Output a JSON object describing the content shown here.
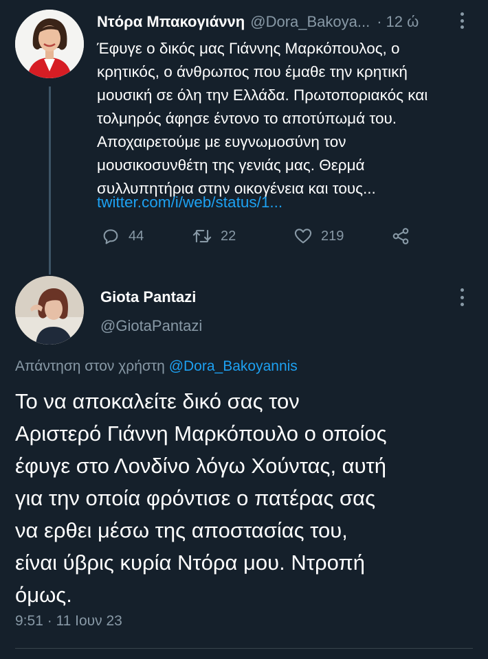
{
  "tweet1": {
    "display_name": "Ντόρα Μπακογιάννη",
    "handle": "@Dora_Bakoya...",
    "separator": "·",
    "time": "12 ώ",
    "text_lines": [
      "Έφυγε ο δικός μας Γιάννης Μαρκόπουλος, ο",
      "κρητικός, ο άνθρωπος που έμαθε την κρητική",
      "μουσική σε όλη την Ελλάδα.  Πρωτοποριακός και",
      "τολμηρός  άφησε έντονο το αποτύπωμά του.",
      "Αποχαιρετούμε με ευγνωμοσύνη τον",
      "μουσικοσυνθέτη της γενιάς μας. Θερμά",
      "συλλυπητήρια στην οικογένεια και τους..."
    ],
    "link": "twitter.com/i/web/status/1...",
    "replies": "44",
    "retweets": "22",
    "likes": "219"
  },
  "tweet2": {
    "display_name": "Giota Pantazi",
    "handle": "@GiotaPantazi",
    "reply_prefix": "Απάντηση στον χρήστη",
    "reply_mention": "@Dora_Bakoyannis",
    "text_lines": [
      "Το να αποκαλείτε δικό σας τον",
      "Αριστερό Γιάννη Μαρκόπουλο ο οποίος",
      "έφυγε στο Λονδίνο λόγω Χούντας, αυτή",
      "για την οποία φρόντισε ο πατέρας σας",
      "να ερθει μέσω της αποστασίας του,",
      "είναι ύβρις κυρία Ντόρα μου. Ντροπή",
      "όμως."
    ],
    "timestamp": "9:51 · 11 Ιουν 23"
  },
  "icons": {
    "reply": "reply-icon",
    "retweet": "retweet-icon",
    "like": "heart-icon",
    "share": "share-icon",
    "more": "more-vertical-icon"
  },
  "colors": {
    "background": "#15202b",
    "text": "#ffffff",
    "secondary": "#8899a6",
    "link": "#1da1f2",
    "thread_line": "#3d5466",
    "divider": "#38444d"
  }
}
